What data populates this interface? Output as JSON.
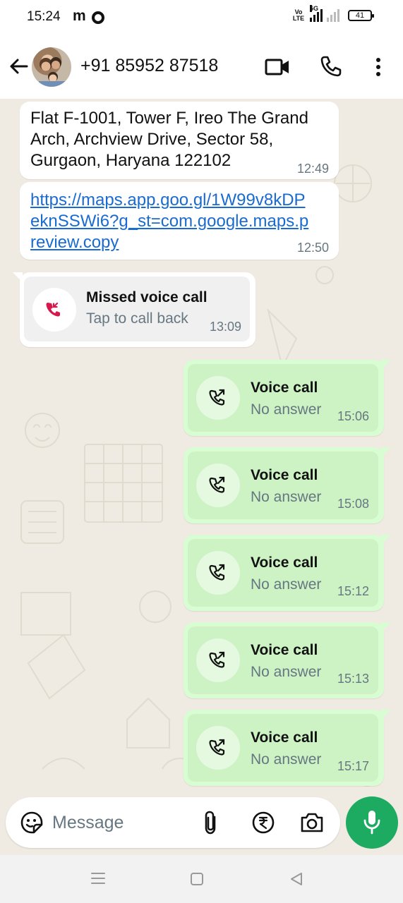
{
  "status_bar": {
    "time": "15:24",
    "m_label": "m",
    "volte": "Vo\nLTE",
    "network": "5G",
    "battery": "41"
  },
  "header": {
    "contact_name": "+91 85952 87518",
    "icons": [
      "back-arrow-icon",
      "avatar",
      "video-icon",
      "call-icon",
      "menu-icon"
    ]
  },
  "messages": [
    {
      "direction": "in",
      "text": "Flat F-1001, Tower F, Ireo The Grand Arch, Archview Drive, Sector 58, Gurgaon, Haryana 122102",
      "time": "12:49"
    },
    {
      "direction": "in",
      "link": "https://maps.app.goo.gl/1W99v8kDPeknSSWi6?g_st=com.google.maps.preview.copy",
      "time": "12:50"
    },
    {
      "direction": "in",
      "call_title": "Missed voice call",
      "call_sub": "Tap to call back",
      "time": "13:09"
    },
    {
      "direction": "out",
      "call_title": "Voice call",
      "call_sub": "No answer",
      "time": "15:06"
    },
    {
      "direction": "out",
      "call_title": "Voice call",
      "call_sub": "No answer",
      "time": "15:08"
    },
    {
      "direction": "out",
      "call_title": "Voice call",
      "call_sub": "No answer",
      "time": "15:12"
    },
    {
      "direction": "out",
      "call_title": "Voice call",
      "call_sub": "No answer",
      "time": "15:13"
    },
    {
      "direction": "out",
      "call_title": "Voice call",
      "call_sub": "No answer",
      "time": "15:17"
    }
  ],
  "input": {
    "placeholder": "Message"
  },
  "colors": {
    "accent": "#1daa61",
    "outgoing_bubble": "#d9fdd3",
    "missed_call": "#d6194b",
    "link": "#1a6bd1"
  }
}
